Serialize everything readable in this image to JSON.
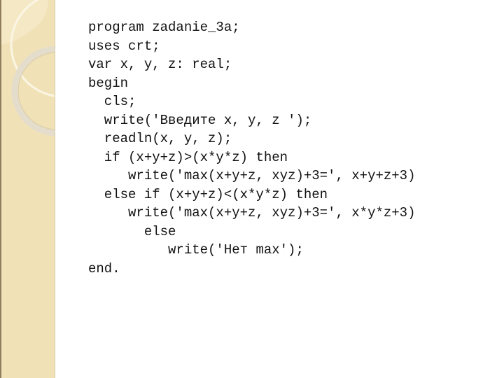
{
  "slide": {
    "background_color": "#ffffff",
    "sidebar_color": "#f0e2b6",
    "text_color": "#111111"
  },
  "code": {
    "language": "Pascal",
    "lines": [
      {
        "indent": 0,
        "text": "program zadanie_3a;"
      },
      {
        "indent": 0,
        "text": "uses crt;"
      },
      {
        "indent": 0,
        "text": "var x, y, z: real;"
      },
      {
        "indent": 0,
        "text": "begin"
      },
      {
        "indent": 2,
        "text": "cls;"
      },
      {
        "indent": 2,
        "text": "write('Введите x, y, z ');"
      },
      {
        "indent": 2,
        "text": "readln(x, y, z);"
      },
      {
        "indent": 2,
        "text": "if (x+y+z)>(x*y*z) then"
      },
      {
        "indent": 5,
        "text": "write('max(x+y+z, xyz)+3=', x+y+z+3)"
      },
      {
        "indent": 2,
        "text": "else if (x+y+z)<(x*y*z) then"
      },
      {
        "indent": 5,
        "text": "write('max(x+y+z, xyz)+3=', x*y*z+3)"
      },
      {
        "indent": 7,
        "text": "else"
      },
      {
        "indent": 10,
        "text": "write('Нет max');"
      },
      {
        "indent": 0,
        "text": "end."
      }
    ]
  }
}
